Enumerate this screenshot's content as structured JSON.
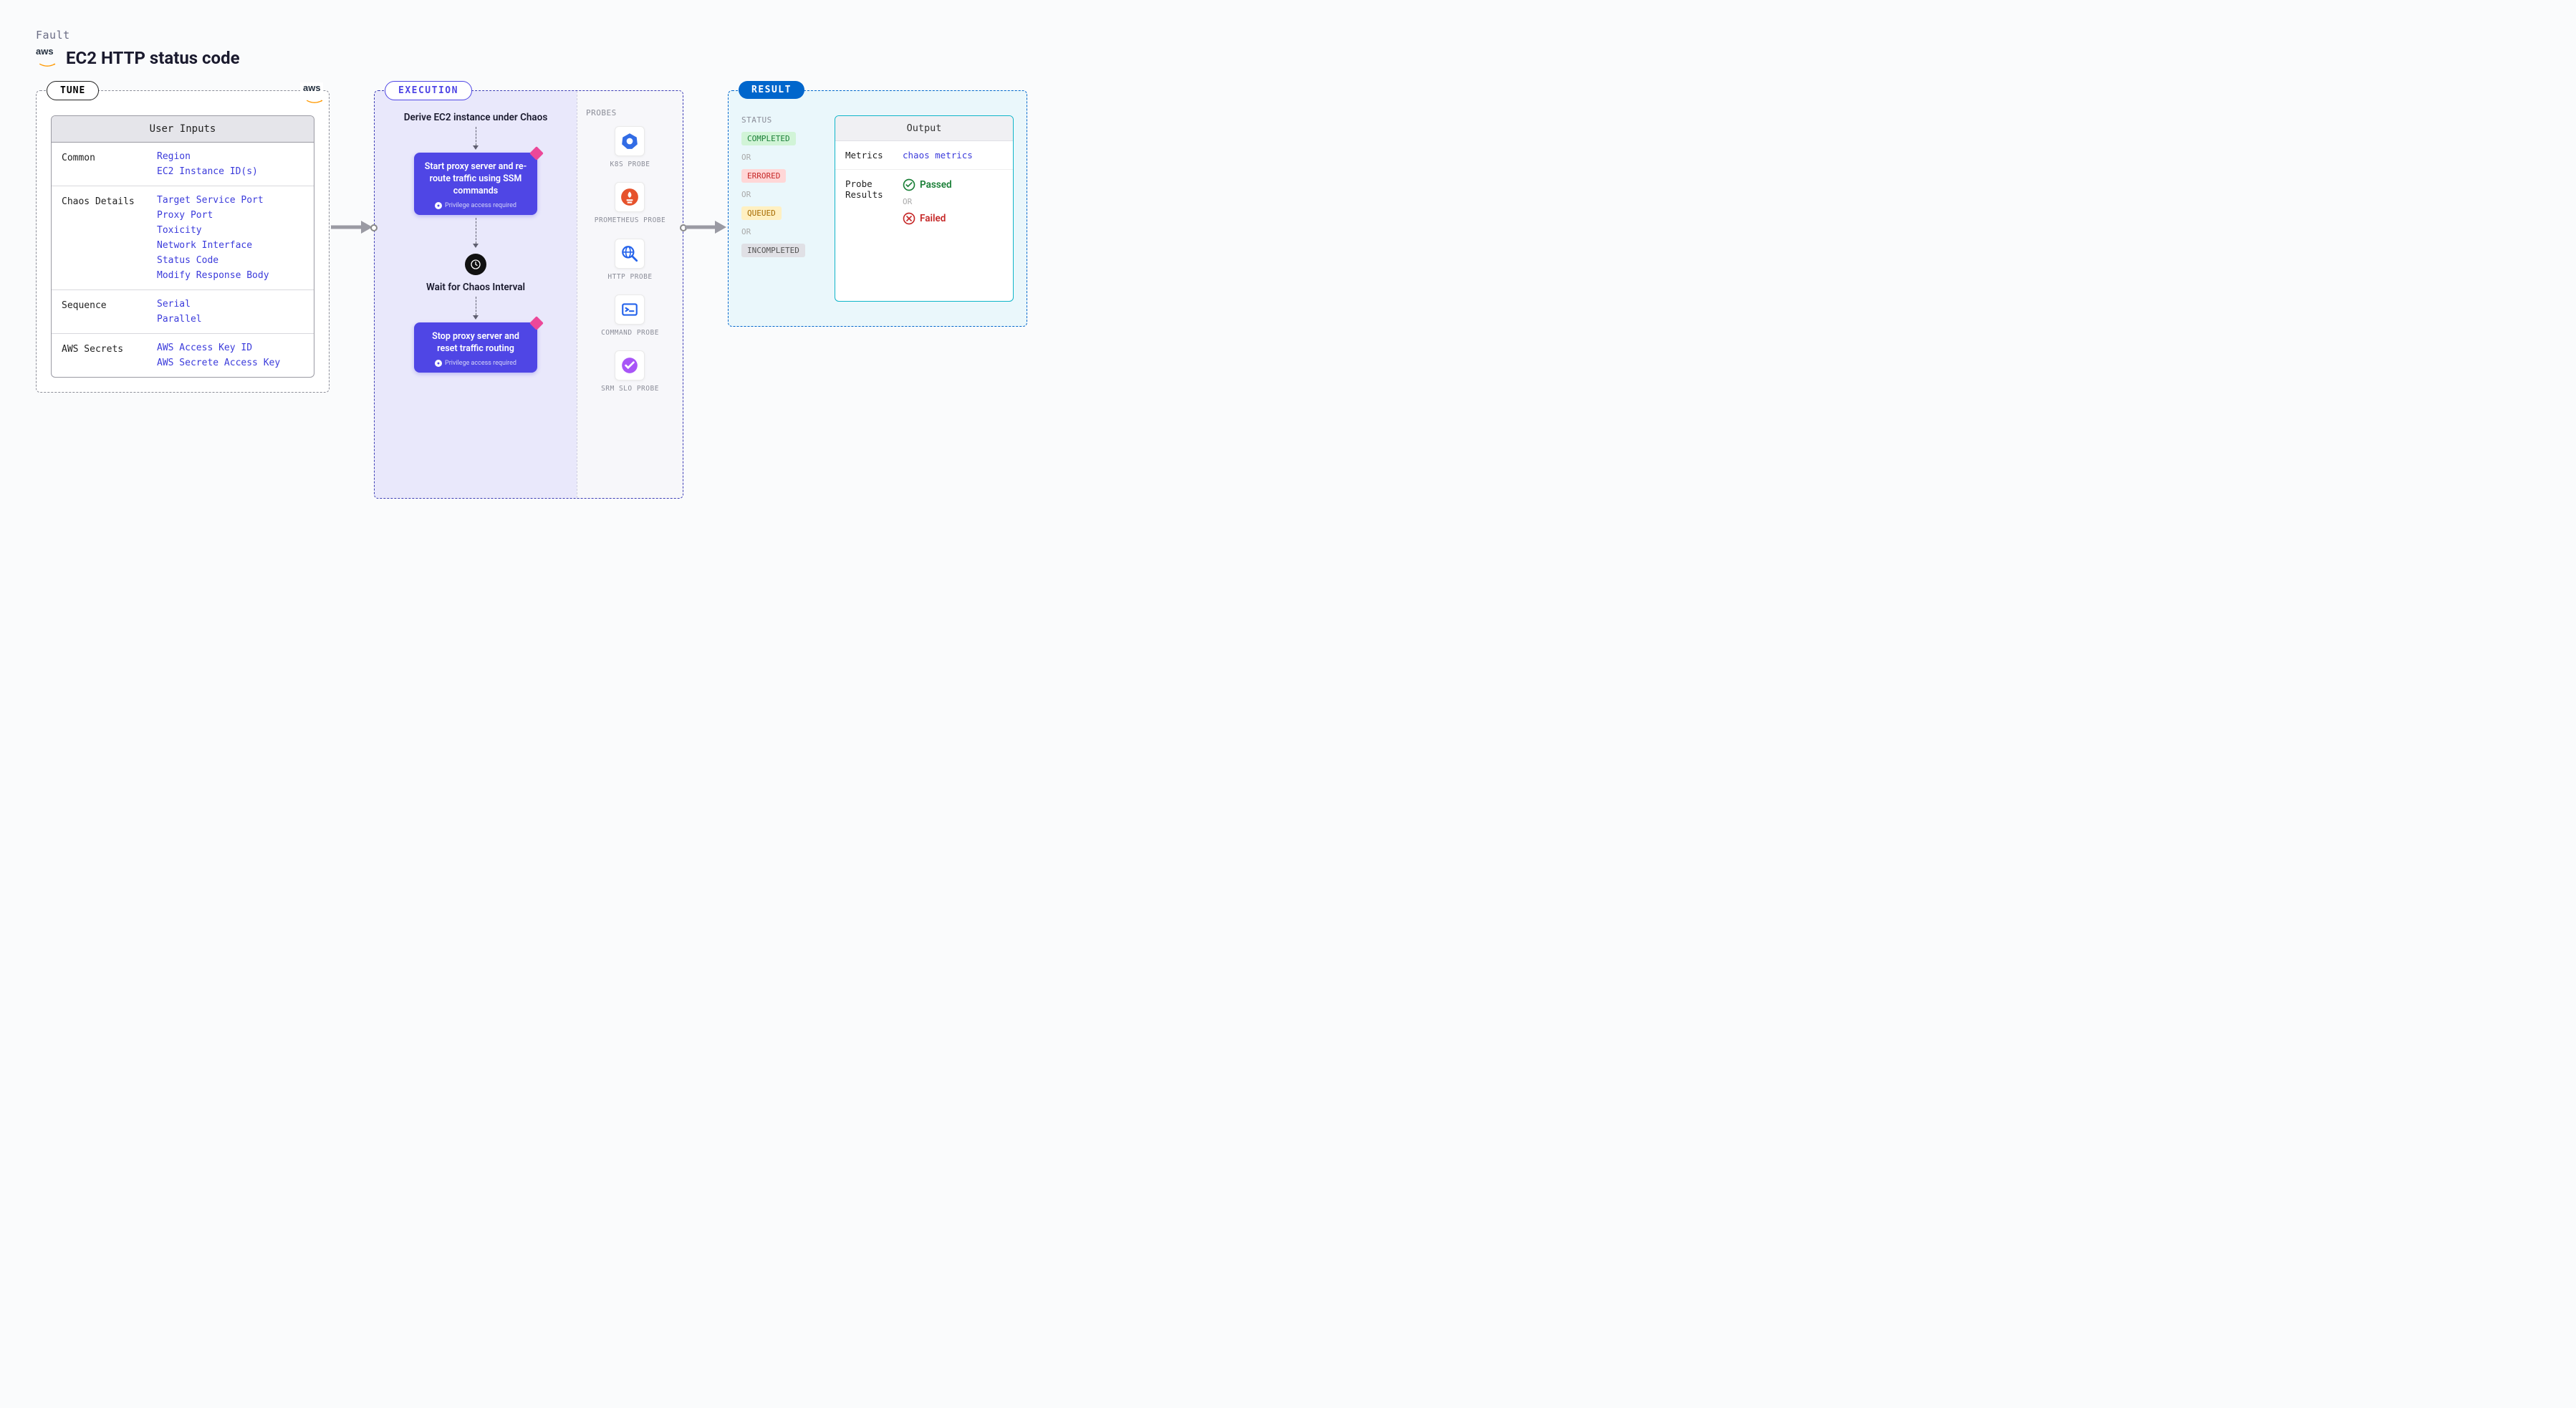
{
  "header": {
    "fault_label": "Fault",
    "title": "EC2 HTTP status code"
  },
  "tune": {
    "badge": "TUNE",
    "inputs_header": "User Inputs",
    "sections": [
      {
        "name": "Common",
        "values": [
          "Region",
          "EC2 Instance ID(s)"
        ]
      },
      {
        "name": "Chaos Details",
        "values": [
          "Target Service Port",
          "Proxy Port",
          "Toxicity",
          "Network Interface",
          "Status Code",
          "Modify Response Body"
        ]
      },
      {
        "name": "Sequence",
        "values": [
          "Serial",
          "Parallel"
        ]
      },
      {
        "name": "AWS Secrets",
        "values": [
          "AWS Access Key ID",
          "AWS Secrete Access Key"
        ]
      }
    ]
  },
  "execution": {
    "badge": "EXECUTION",
    "step1": "Derive EC2 instance under Chaos",
    "card1_title": "Start proxy server and re-route traffic using SSM commands",
    "card_sub": "Privilege access required",
    "step_wait": "Wait for Chaos Interval",
    "card2_title": "Stop proxy server and reset traffic routing",
    "probes_label": "PROBES",
    "probes": [
      {
        "label": "K8S PROBE",
        "icon": "k8s"
      },
      {
        "label": "PROMETHEUS PROBE",
        "icon": "prometheus"
      },
      {
        "label": "HTTP PROBE",
        "icon": "http"
      },
      {
        "label": "COMMAND PROBE",
        "icon": "command"
      },
      {
        "label": "SRM SLO PROBE",
        "icon": "srm"
      }
    ]
  },
  "result": {
    "badge": "RESULT",
    "status_header": "STATUS",
    "or": "OR",
    "statuses": [
      {
        "text": "COMPLETED",
        "cls": "pill-green"
      },
      {
        "text": "ERRORED",
        "cls": "pill-red"
      },
      {
        "text": "QUEUED",
        "cls": "pill-yellow"
      },
      {
        "text": "INCOMPLETED",
        "cls": "pill-grey"
      }
    ],
    "output_header": "Output",
    "metrics_label": "Metrics",
    "metrics_value": "chaos metrics",
    "probe_results_label": "Probe Results",
    "passed": "Passed",
    "failed": "Failed"
  }
}
